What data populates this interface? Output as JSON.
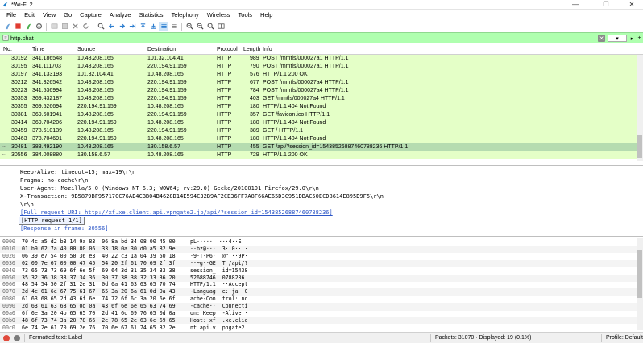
{
  "window": {
    "title": "*Wi-Fi 2",
    "minimize": "—",
    "maximize": "❐",
    "close": "✕"
  },
  "menu": [
    "File",
    "Edit",
    "View",
    "Go",
    "Capture",
    "Analyze",
    "Statistics",
    "Telephony",
    "Wireless",
    "Tools",
    "Help"
  ],
  "filter": {
    "value": "http.chat",
    "clear_label": "✕",
    "dropdown_label": "▾",
    "apply_label": "▸",
    "plus_label": "+"
  },
  "columns": {
    "no": "No.",
    "time": "Time",
    "source": "Source",
    "destination": "Destination",
    "protocol": "Protocol",
    "length": "Length",
    "info": "Info"
  },
  "packets": [
    {
      "no": "30192",
      "time": "341.186548",
      "src": "10.48.208.165",
      "dst": "101.32.104.41",
      "proto": "HTTP",
      "len": "989",
      "info": "POST /mmtls/000027a1 HTTP/1.1"
    },
    {
      "no": "30195",
      "time": "341.111703",
      "src": "10.48.208.165",
      "dst": "220.194.91.159",
      "proto": "HTTP",
      "len": "790",
      "info": "POST /mmtls/000027a1 HTTP/1.1"
    },
    {
      "no": "30197",
      "time": "341.133193",
      "src": "101.32.104.41",
      "dst": "10.48.208.165",
      "proto": "HTTP",
      "len": "576",
      "info": "HTTP/1.1 200 OK"
    },
    {
      "no": "30212",
      "time": "341.326542",
      "src": "10.48.208.165",
      "dst": "220.194.91.159",
      "proto": "HTTP",
      "len": "677",
      "info": "POST /mmtls/000027a4 HTTP/1.1"
    },
    {
      "no": "30223",
      "time": "341.536994",
      "src": "10.48.208.165",
      "dst": "220.194.91.159",
      "proto": "HTTP",
      "len": "784",
      "info": "POST /mmtls/000027a4 HTTP/1.1"
    },
    {
      "no": "30353",
      "time": "369.432187",
      "src": "10.48.208.165",
      "dst": "220.194.91.159",
      "proto": "HTTP",
      "len": "403",
      "info": "GET /mmtls/000027a4 HTTP/1.1"
    },
    {
      "no": "30355",
      "time": "369.526694",
      "src": "220.194.91.159",
      "dst": "10.48.208.165",
      "proto": "HTTP",
      "len": "180",
      "info": "HTTP/1.1 404 Not Found"
    },
    {
      "no": "30381",
      "time": "369.601941",
      "src": "10.48.208.165",
      "dst": "220.194.91.159",
      "proto": "HTTP",
      "len": "357",
      "info": "GET /favicon.ico HTTP/1.1"
    },
    {
      "no": "30414",
      "time": "369.704206",
      "src": "220.194.91.159",
      "dst": "10.48.208.165",
      "proto": "HTTP",
      "len": "180",
      "info": "HTTP/1.1 404 Not Found"
    },
    {
      "no": "30459",
      "time": "378.610139",
      "src": "10.48.208.165",
      "dst": "220.194.91.159",
      "proto": "HTTP",
      "len": "389",
      "info": "GET / HTTP/1.1"
    },
    {
      "no": "30463",
      "time": "378.704691",
      "src": "220.194.91.159",
      "dst": "10.48.208.165",
      "proto": "HTTP",
      "len": "180",
      "info": "HTTP/1.1 404 Not Found"
    },
    {
      "no": "30481",
      "time": "383.492190",
      "src": "10.48.208.165",
      "dst": "130.158.6.57",
      "proto": "HTTP",
      "len": "455",
      "info": "GET /api/?session_id=15438526887460788236 HTTP/1.1"
    },
    {
      "no": "30556",
      "time": "384.008880",
      "src": "130.158.6.57",
      "dst": "10.48.208.165",
      "proto": "HTTP",
      "len": "729",
      "info": "HTTP/1.1 200 OK"
    }
  ],
  "details": [
    "Keep-Alive: timeout=15; max=19\\r\\n",
    "Pragma: no-cache\\r\\n",
    "User-Agent: Mozilla/5.0 (Windows NT 6.3; WOW64; rv:29.0) Gecko/20100101 Firefox/29.0\\r\\n",
    "X-Transaction: 9B5879BF95717CC76AE4CBB04B4628D14E594C32B9AF2CB36FF7A8F66AE65D3C951DBAC50ECD8614E895D9F5\\r\\n",
    "\\r\\n",
    "[Full request URI: http://xf.xe.client.api.vpngate2.jp/api/?session_id=15438526887460788236]",
    "[HTTP request 1/1]",
    "[Response in frame: 30556]"
  ],
  "hex": [
    {
      "off": "0000",
      "bytes": "70 4c a5 d2 b3 14 9a 83  06 8a bd 34 08 00 45 00",
      "ascii": "pL·····  ···4··E·"
    },
    {
      "off": "0010",
      "bytes": "01 b9 62 7a 40 00 80 06  33 18 0a 30 d0 a5 82 9e",
      "ascii": "··bz@···  3··0····"
    },
    {
      "off": "0020",
      "bytes": "06 39 e7 54 00 50 36 e3  40 22 c3 1a 04 39 50 18",
      "ascii": "·9·T·P6·  @\"···9P·"
    },
    {
      "off": "0030",
      "bytes": "02 00 7e 67 00 00 47 45  54 20 2f 61 70 69 2f 3f",
      "ascii": "··~g··GE  T /api/?"
    },
    {
      "off": "0040",
      "bytes": "73 65 73 73 69 6f 6e 5f  69 64 3d 31 35 34 33 38",
      "ascii": "session_  id=15438"
    },
    {
      "off": "0050",
      "bytes": "35 32 36 38 38 37 34 36  30 37 38 38 32 33 36 20",
      "ascii": "52688746  0788236 "
    },
    {
      "off": "0060",
      "bytes": "48 54 54 50 2f 31 2e 31  0d 0a 41 63 63 65 70 74",
      "ascii": "HTTP/1.1  ··Accept"
    },
    {
      "off": "0070",
      "bytes": "2d 4c 61 6e 67 75 61 67  65 3a 20 6a 61 0d 0a 43",
      "ascii": "-Languag  e: ja··C"
    },
    {
      "off": "0080",
      "bytes": "61 63 68 65 2d 43 6f 6e  74 72 6f 6c 3a 20 6e 6f",
      "ascii": "ache-Con  trol: no"
    },
    {
      "off": "0090",
      "bytes": "2d 63 61 63 68 65 0d 0a  43 6f 6e 6e 65 63 74 69",
      "ascii": "-cache··  Connecti"
    },
    {
      "off": "00a0",
      "bytes": "6f 6e 3a 20 4b 65 65 70  2d 41 6c 69 76 65 0d 0a",
      "ascii": "on: Keep  -Alive··"
    },
    {
      "off": "00b0",
      "bytes": "48 6f 73 74 3a 20 78 66  2e 78 65 2e 63 6c 69 65",
      "ascii": "Host: xf  .xe.clie"
    },
    {
      "off": "00c0",
      "bytes": "6e 74 2e 61 70 69 2e 76  70 6e 67 61 74 65 32 2e",
      "ascii": "nt.api.v  pngate2."
    }
  ],
  "status": {
    "text": "Formatted text: Label",
    "packets": "Packets: 31070 · Displayed: 19 (0.1%)",
    "profile": "Profile: Default"
  },
  "colors": {
    "filter_bg": "#afffaf",
    "http_row": "#e4ffc7",
    "selected_row": "#b5dcb0",
    "link": "#2c56c7"
  }
}
